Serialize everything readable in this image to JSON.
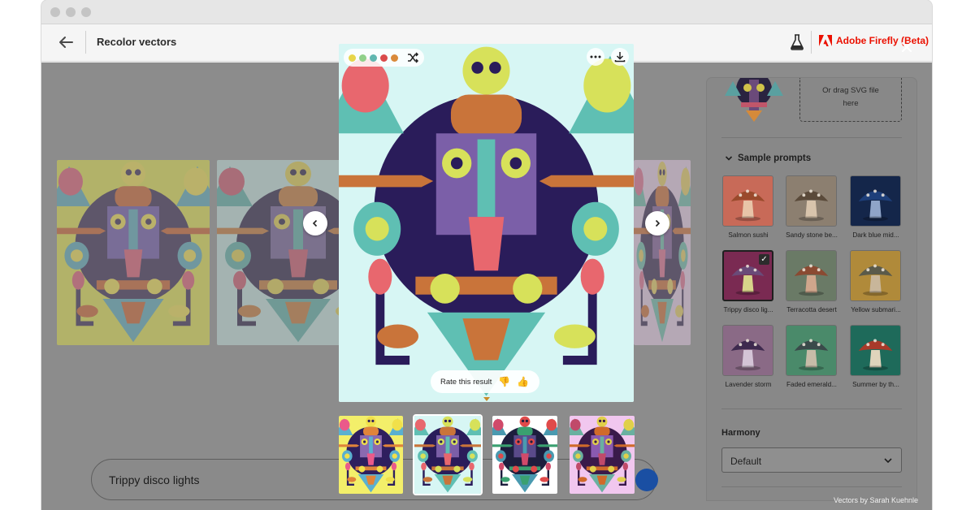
{
  "app": {
    "page_title": "Recolor vectors",
    "brand_name": "Adobe Firefly (Beta)",
    "brand_color": "#eb1000"
  },
  "gallery": {
    "backgrounds": [
      "#d2d24e",
      "#b8d4d0",
      "#d7bfd8"
    ]
  },
  "preview": {
    "background": "#d7f6f4",
    "palette_swatches": [
      "#e7d64a",
      "#8fd18a",
      "#5fb7b0",
      "#d94b4b",
      "#d98a3a"
    ],
    "rate_label": "Rate this result",
    "icons": [
      "shuffle-icon",
      "more-icon",
      "download-icon",
      "thumbs-down-icon",
      "thumbs-up-icon"
    ]
  },
  "thumbnails": [
    {
      "bg": "#f3ef6a",
      "selected": false
    },
    {
      "bg": "#d7f6f4",
      "selected": true
    },
    {
      "bg": "#ffffff",
      "selected": false
    },
    {
      "bg": "#f1c7ef",
      "selected": false
    }
  ],
  "panel": {
    "drop_text_line1": "Or drag SVG file",
    "drop_text_line2": "here",
    "sample_prompts_title": "Sample prompts",
    "samples": [
      {
        "label": "Salmon sushi",
        "bg": "#c86a58",
        "cap": "#9a4a2c",
        "stem": "#e8c4a8",
        "selected": false
      },
      {
        "label": "Sandy stone be...",
        "bg": "#8c7f70",
        "cap": "#5a4a3a",
        "stem": "#d8c4ac",
        "selected": false
      },
      {
        "label": "Dark blue mid...",
        "bg": "#14264a",
        "cap": "#1e3f7a",
        "stem": "#8fa4c8",
        "selected": false
      },
      {
        "label": "Trippy disco lig...",
        "bg": "#7a2a52",
        "cap": "#6a4a78",
        "stem": "#d8d48a",
        "selected": true
      },
      {
        "label": "Terracotta desert",
        "bg": "#6a7a66",
        "cap": "#8a4a32",
        "stem": "#d0a68c",
        "selected": false
      },
      {
        "label": "Yellow submari...",
        "bg": "#b08a3a",
        "cap": "#5a5a4a",
        "stem": "#c8b69a",
        "selected": false
      },
      {
        "label": "Lavender storm",
        "bg": "#8a6a86",
        "cap": "#3e2a4e",
        "stem": "#d4c4d6",
        "selected": false
      },
      {
        "label": "Faded emerald...",
        "bg": "#4a8a6a",
        "cap": "#3a4a4a",
        "stem": "#c8bca8",
        "selected": false
      },
      {
        "label": "Summer by th...",
        "bg": "#1e6a5a",
        "cap": "#a83a2a",
        "stem": "#e0d4bc",
        "selected": false
      }
    ],
    "harmony_label": "Harmony",
    "harmony_value": "Default"
  },
  "prompt": {
    "value": "Trippy disco lights"
  },
  "credit": "Vectors by Sarah Kuehnle"
}
